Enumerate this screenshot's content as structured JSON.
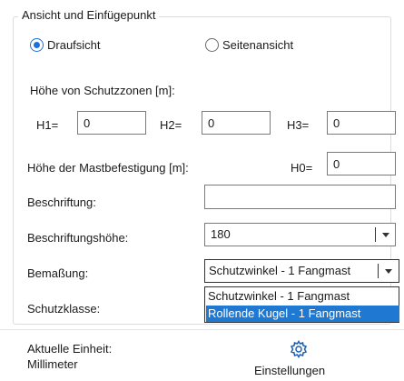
{
  "group": {
    "title": "Ansicht und Einfügepunkt"
  },
  "view": {
    "options": [
      {
        "label": "Draufsicht",
        "checked": true
      },
      {
        "label": "Seitenansicht",
        "checked": false
      }
    ]
  },
  "zones": {
    "heading": "Höhe von Schutzzonen [m]:",
    "h1_label": "H1=",
    "h1_value": "0",
    "h2_label": "H2=",
    "h2_value": "0",
    "h3_label": "H3=",
    "h3_value": "0"
  },
  "mast": {
    "label": "Höhe der Mastbefestigung [m]:",
    "h0_label": "H0=",
    "h0_value": "0"
  },
  "caption": {
    "label": "Beschriftung:",
    "value": ""
  },
  "caption_height": {
    "label": "Beschriftungshöhe:",
    "value": "180"
  },
  "dimensioning": {
    "label": "Bemaßung:",
    "value": "Schutzwinkel - 1 Fangmast",
    "options": [
      "Schutzwinkel - 1 Fangmast",
      "Rollende Kugel - 1 Fangmast"
    ],
    "highlighted_index": 1
  },
  "protection_class": {
    "label": "Schutzklasse:"
  },
  "footer": {
    "unit_label": "Aktuelle Einheit:",
    "unit_value": "Millimeter",
    "settings_label": "Einstellungen",
    "settings_icon": "gear-icon"
  },
  "colors": {
    "accent": "#1e6fd9",
    "selection": "#1f78d1"
  }
}
